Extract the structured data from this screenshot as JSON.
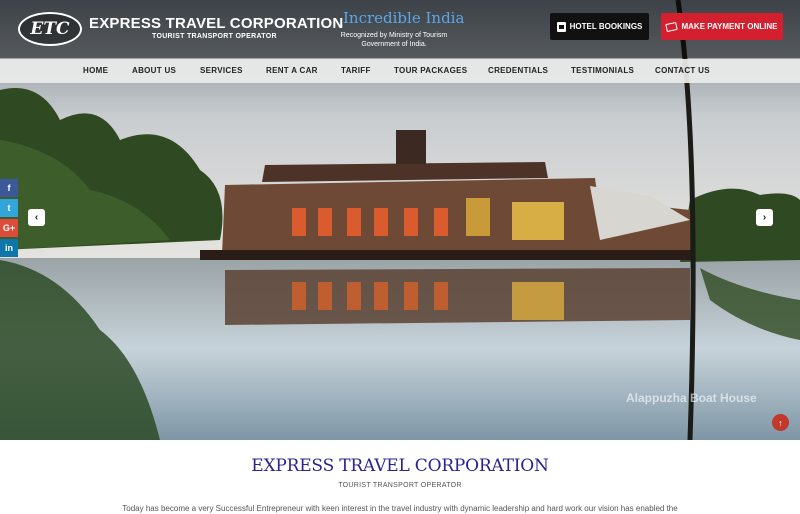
{
  "header": {
    "logo_text": "ETC",
    "brand_name": "EXPRESS TRAVEL CORPORATION",
    "brand_subtitle": "TOURIST TRANSPORT OPERATOR",
    "incredible_india": "Incredible India",
    "recognition": "Recognized by Ministry of Tourism Government of India.",
    "hotel_button": "HOTEL BOOKINGS",
    "payment_button": "MAKE PAYMENT ONLINE"
  },
  "nav": {
    "items": [
      "HOME",
      "ABOUT US",
      "SERVICES",
      "RENT A CAR",
      "TARIFF",
      "TOUR PACKAGES",
      "CREDENTIALS",
      "TESTIMONIALS",
      "CONTACT US"
    ]
  },
  "social": {
    "facebook": "f",
    "twitter": "t",
    "googleplus": "G+",
    "linkedin": "in"
  },
  "slider": {
    "caption": "Alappuzha Boat House",
    "prev_icon": "chevron-left-icon",
    "next_icon": "chevron-right-icon",
    "prev_glyph": "‹",
    "next_glyph": "›"
  },
  "scroll_top_glyph": "↑",
  "content": {
    "title": "EXPRESS TRAVEL CORPORATION",
    "subtitle": "TOURIST TRANSPORT OPERATOR",
    "intro": "Today has become a very Successful Entrepreneur with keen interest in the travel industry with dynamic leadership and hard work our vision has enabled the"
  },
  "colors": {
    "brand_blue": "#2a2290",
    "pay_red": "#d31f2e",
    "incredible_blue": "#5da6e8"
  }
}
